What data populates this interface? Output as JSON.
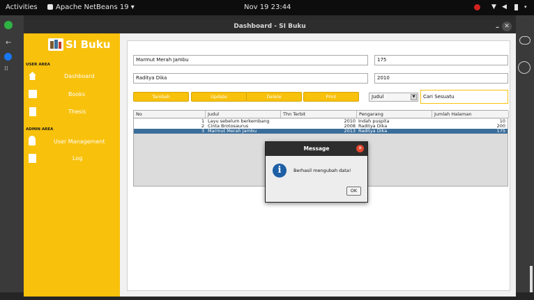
{
  "topbar": {
    "activities": "Activities",
    "app": "Apache NetBeans 19 ▾",
    "datetime": "Nov 19  23:44"
  },
  "window": {
    "title": "Dashboard - SI Buku"
  },
  "sidebar": {
    "brand": "SI Buku",
    "user_area": "USER AREA",
    "admin_area": "ADMIN AREA",
    "items": [
      {
        "label": "Dashboard",
        "icon": "home-icon"
      },
      {
        "label": "Books",
        "icon": "books-icon"
      },
      {
        "label": "Thesis",
        "icon": "thesis-icon"
      },
      {
        "label": "User Management",
        "icon": "user-icon"
      },
      {
        "label": "Log",
        "icon": "log-icon"
      }
    ]
  },
  "form": {
    "judul": "Marmut Merah Jambu",
    "jumlah_halaman": "175",
    "pengarang": "Raditya Dika",
    "tahun": "2010",
    "buttons": {
      "tambah": "Tambah",
      "update": "Update",
      "delete": "Delete",
      "print": "Print"
    },
    "search_by": "Judul",
    "search_value": "Cari Sesuatu"
  },
  "table": {
    "columns": [
      "No",
      "Judul",
      "Thn Terbit",
      "Pengarang",
      "Jumlah Halaman"
    ],
    "rows": [
      {
        "no": "1",
        "judul": "Layu sebelum berkembang",
        "thn": "2010",
        "pengarang": "Indah puspita",
        "jumlah": "10"
      },
      {
        "no": "2",
        "judul": "Cinta Brotosaurus",
        "thn": "2008",
        "pengarang": "Raditya Dika",
        "jumlah": "200"
      },
      {
        "no": "3",
        "judul": "Marmut Merah Jambu",
        "thn": "2013",
        "pengarang": "Raditya Dika",
        "jumlah": "175"
      }
    ]
  },
  "dialog": {
    "title": "Message",
    "message": "Berhasil mengubah data!",
    "ok": "OK"
  },
  "colors": {
    "accent": "#f8c10c",
    "selection": "#3b6e9a",
    "dialog_close": "#e2452c"
  }
}
